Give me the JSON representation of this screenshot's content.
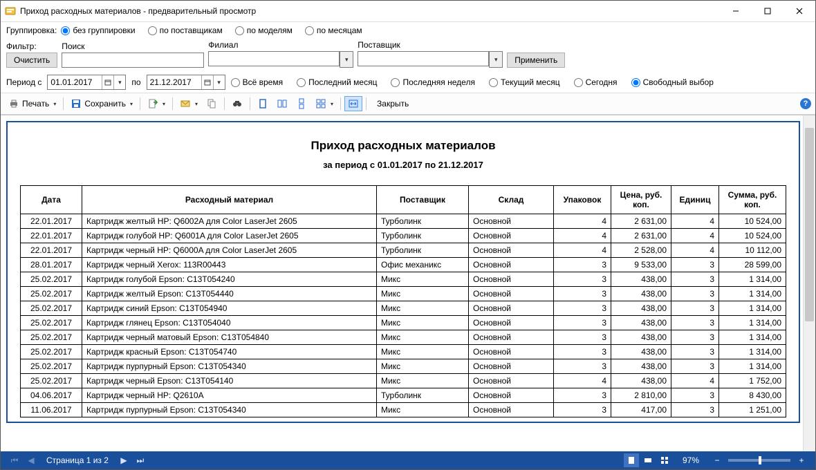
{
  "window": {
    "title": "Приход расходных материалов - предварительный просмотр"
  },
  "grouping": {
    "label": "Группировка:",
    "options": [
      "без группировки",
      "по поставщикам",
      "по моделям",
      "по месяцам"
    ]
  },
  "filter": {
    "label": "Фильтр:",
    "clear": "Очистить",
    "search_label": "Поиск",
    "branch_label": "Филиал",
    "supplier_label": "Поставщик",
    "apply": "Применить"
  },
  "period": {
    "from_label": "Период с",
    "to_label": "по",
    "from": "01.01.2017",
    "to": "21.12.2017",
    "options": [
      "Всё время",
      "Последний месяц",
      "Последняя неделя",
      "Текущий месяц",
      "Сегодня",
      "Свободный выбор"
    ]
  },
  "toolbar": {
    "print": "Печать",
    "save": "Сохранить",
    "close": "Закрыть"
  },
  "report": {
    "title": "Приход расходных материалов",
    "subtitle": "за период с 01.01.2017 по 21.12.2017",
    "columns": [
      "Дата",
      "Расходный материал",
      "Поставщик",
      "Склад",
      "Упаковок",
      "Цена, руб. коп.",
      "Единиц",
      "Сумма, руб. коп."
    ],
    "rows": [
      {
        "date": "22.01.2017",
        "material": "Картридж желтый HP: Q6002A для Color LaserJet 2605",
        "supplier": "Турболинк",
        "warehouse": "Основной",
        "packs": "4",
        "price": "2 631,00",
        "units": "4",
        "sum": "10 524,00"
      },
      {
        "date": "22.01.2017",
        "material": "Картридж голубой HP: Q6001A для Color LaserJet 2605",
        "supplier": "Турболинк",
        "warehouse": "Основной",
        "packs": "4",
        "price": "2 631,00",
        "units": "4",
        "sum": "10 524,00"
      },
      {
        "date": "22.01.2017",
        "material": "Картридж черный HP: Q6000A для Color LaserJet 2605",
        "supplier": "Турболинк",
        "warehouse": "Основной",
        "packs": "4",
        "price": "2 528,00",
        "units": "4",
        "sum": "10 112,00"
      },
      {
        "date": "28.01.2017",
        "material": "Картридж черный Xerox: 113R00443",
        "supplier": "Офис механикс",
        "warehouse": "Основной",
        "packs": "3",
        "price": "9 533,00",
        "units": "3",
        "sum": "28 599,00"
      },
      {
        "date": "25.02.2017",
        "material": "Картридж голубой Epson: C13T054240",
        "supplier": "Микс",
        "warehouse": "Основной",
        "packs": "3",
        "price": "438,00",
        "units": "3",
        "sum": "1 314,00"
      },
      {
        "date": "25.02.2017",
        "material": "Картридж желтый Epson: C13T054440",
        "supplier": "Микс",
        "warehouse": "Основной",
        "packs": "3",
        "price": "438,00",
        "units": "3",
        "sum": "1 314,00"
      },
      {
        "date": "25.02.2017",
        "material": "Картридж синий Epson: C13T054940",
        "supplier": "Микс",
        "warehouse": "Основной",
        "packs": "3",
        "price": "438,00",
        "units": "3",
        "sum": "1 314,00"
      },
      {
        "date": "25.02.2017",
        "material": "Картридж глянец Epson: C13T054040",
        "supplier": "Микс",
        "warehouse": "Основной",
        "packs": "3",
        "price": "438,00",
        "units": "3",
        "sum": "1 314,00"
      },
      {
        "date": "25.02.2017",
        "material": "Картридж черный матовый Epson: C13T054840",
        "supplier": "Микс",
        "warehouse": "Основной",
        "packs": "3",
        "price": "438,00",
        "units": "3",
        "sum": "1 314,00"
      },
      {
        "date": "25.02.2017",
        "material": "Картридж красный Epson: C13T054740",
        "supplier": "Микс",
        "warehouse": "Основной",
        "packs": "3",
        "price": "438,00",
        "units": "3",
        "sum": "1 314,00"
      },
      {
        "date": "25.02.2017",
        "material": "Картридж пурпурный Epson: C13T054340",
        "supplier": "Микс",
        "warehouse": "Основной",
        "packs": "3",
        "price": "438,00",
        "units": "3",
        "sum": "1 314,00"
      },
      {
        "date": "25.02.2017",
        "material": "Картридж черный Epson: C13T054140",
        "supplier": "Микс",
        "warehouse": "Основной",
        "packs": "4",
        "price": "438,00",
        "units": "4",
        "sum": "1 752,00"
      },
      {
        "date": "04.06.2017",
        "material": "Картридж черный HP: Q2610A",
        "supplier": "Турболинк",
        "warehouse": "Основной",
        "packs": "3",
        "price": "2 810,00",
        "units": "3",
        "sum": "8 430,00"
      },
      {
        "date": "11.06.2017",
        "material": "Картридж пурпурный Epson: C13T054340",
        "supplier": "Микс",
        "warehouse": "Основной",
        "packs": "3",
        "price": "417,00",
        "units": "3",
        "sum": "1 251,00"
      }
    ]
  },
  "status": {
    "page_text": "Страница 1 из 2",
    "zoom": "97%"
  }
}
